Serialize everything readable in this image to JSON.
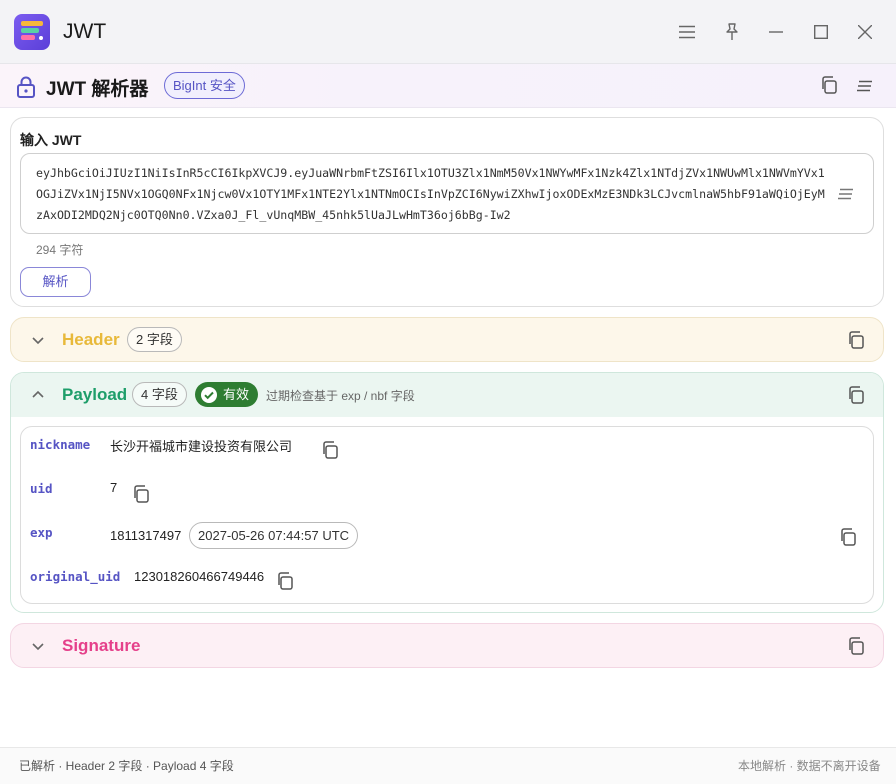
{
  "window": {
    "title": "JWT"
  },
  "tool": {
    "title": "JWT 解析器",
    "badge": "BigInt 安全"
  },
  "input": {
    "label": "输入 JWT",
    "value": "eyJhbGciOiJIUzI1NiIsInR5cCI6IkpXVCJ9.eyJuaWNrbmFtZSI6Ilx1OTU3Zlx1NmM50Vx1NWYwMFx1Nzk4Zlx1NTdjZVx1NWUwMlx1NWVmYVx1OGJiZVx1NjI5NVx1OGQ0NFx1Njcw0Vx1OTY1MFx1NTE2Ylx1NTNmOCIsInVpZCI6NywiZXhwIjoxODExMzE3NDk3LCJvcmlnaW5hbF91aWQiOjEyMzAxODI2MDQ2Njc0OTQ0Nn0.VZxa0J_Fl_vUnqMBW_45nhk5lUaJLwHmT36oj6bBg-Iw2",
    "char_count": "294 字符",
    "parse_label": "解析"
  },
  "header": {
    "title": "Header",
    "count": "2 字段",
    "color": "#e8b93a"
  },
  "payload": {
    "title": "Payload",
    "count": "4 字段",
    "valid_label": "有效",
    "note": "过期检查基于 exp / nbf 字段",
    "color": "#1e9e6a",
    "fields": [
      {
        "key": "nickname",
        "value": "长沙开福城市建设投资有限公司"
      },
      {
        "key": "uid",
        "value": "7"
      },
      {
        "key": "exp",
        "value": "1811317497",
        "date": "2027-05-26 07:44:57 UTC"
      },
      {
        "key": "original_uid",
        "value": "123018260466749446"
      }
    ]
  },
  "signature": {
    "title": "Signature",
    "color": "#e5408a"
  },
  "status": {
    "left": "已解析 · Header 2 字段 · Payload 4 字段",
    "right": "本地解析 · 数据不离开设备"
  }
}
